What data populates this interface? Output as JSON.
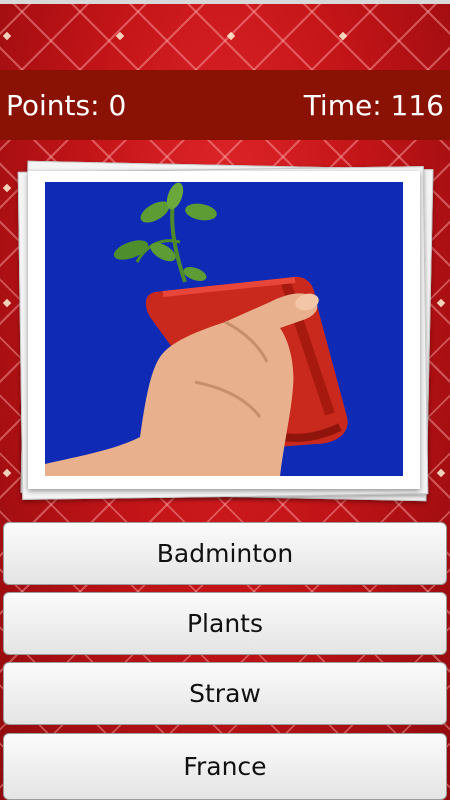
{
  "header": {
    "points_label": "Points: 0",
    "time_label": "Time: 116"
  },
  "question": {
    "image_icon": "hand-holding-plant-pot-photo"
  },
  "answers": [
    {
      "label": "Badminton"
    },
    {
      "label": "Plants"
    },
    {
      "label": "Straw"
    },
    {
      "label": "France"
    }
  ],
  "colors": {
    "background": "#b40f12",
    "score_bar": "#8a1204",
    "photo_sky": "#0f2bb5",
    "pot": "#c9281c"
  }
}
